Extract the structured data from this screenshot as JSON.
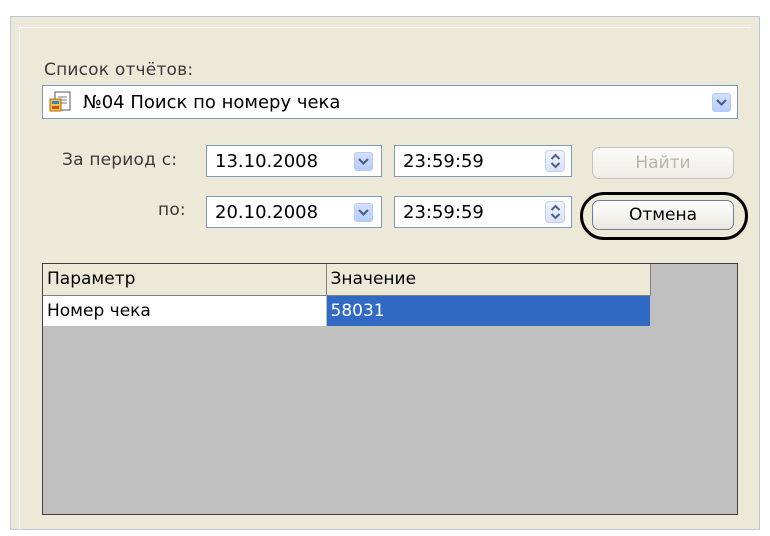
{
  "dialog": {
    "report_list_label": "Список отчётов:",
    "report_selected": "№04 Поиск по номеру чека",
    "period_from_label": "За период с:",
    "period_to_label": "по:",
    "from_date": "13.10.2008",
    "from_time": "23:59:59",
    "to_date": "20.10.2008",
    "to_time": "23:59:59",
    "find_button": "Найти",
    "cancel_button": "Отмена"
  },
  "grid": {
    "columns": [
      "Параметр",
      "Значение"
    ],
    "rows": [
      [
        "Номер чека",
        "58031"
      ]
    ]
  },
  "colors": {
    "dialog_bg": "#ece9d8",
    "selection": "#316ac5",
    "grid_empty": "#c0c0c0"
  },
  "icons": {
    "report": "report-document-icon",
    "dropdown": "chevron-down-icon",
    "spinner": "up-down-spinner-icon"
  }
}
